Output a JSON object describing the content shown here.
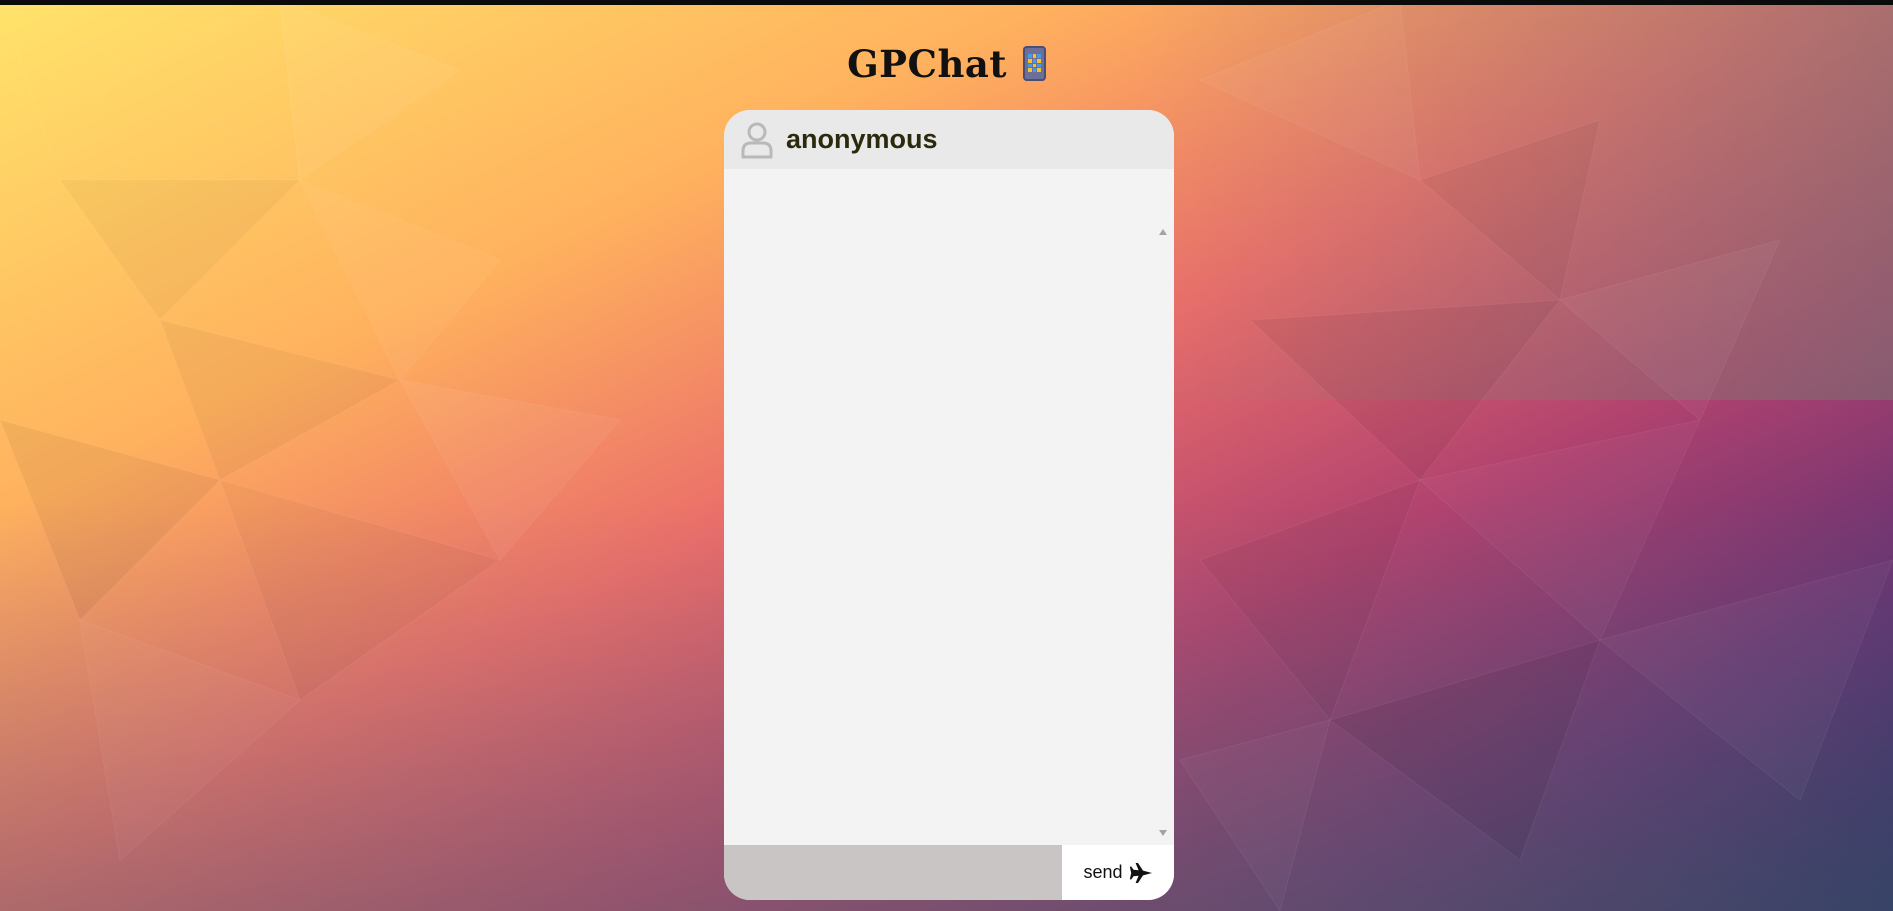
{
  "app": {
    "title": "GPChat",
    "title_icon": "mobile-phone-icon"
  },
  "chat": {
    "username": "anonymous",
    "avatar_icon": "user-outline-icon",
    "messages": [],
    "input": {
      "value": "",
      "placeholder": ""
    },
    "send": {
      "label": "send",
      "icon": "airplane-icon"
    }
  },
  "colors": {
    "header_bg": "#e9e9e9",
    "messages_bg": "#f3f3f3",
    "input_bg": "#c9c5c5",
    "send_bg": "#ffffff",
    "username_color": "#2b2a0c"
  }
}
